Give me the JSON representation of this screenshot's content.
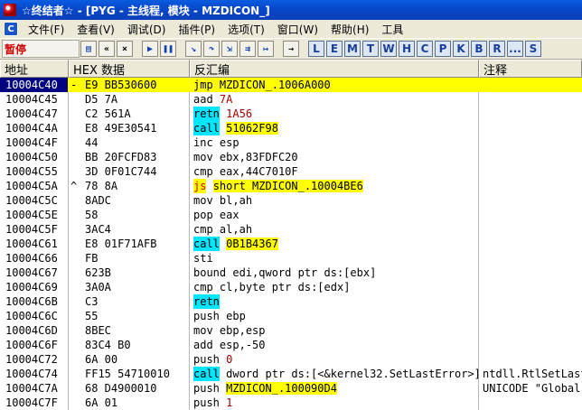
{
  "window": {
    "title": "☆终结者☆ - [PYG - 主线程, 模块 - MZDICON_]"
  },
  "menu": {
    "items": [
      "文件(F)",
      "查看(V)",
      "调试(D)",
      "插件(P)",
      "选项(T)",
      "窗口(W)",
      "帮助(H)",
      "工具"
    ]
  },
  "toolbar": {
    "status": "暂停",
    "letter_buttons": [
      "L",
      "E",
      "M",
      "T",
      "W",
      "H",
      "C",
      "P",
      "K",
      "B",
      "R",
      "...",
      "S"
    ]
  },
  "columns": {
    "address": "地址",
    "hex": "HEX 数据",
    "disassembly": "反汇编",
    "comment": "注释"
  },
  "rows": [
    {
      "addr": "10004C40",
      "mark": "-",
      "hex": "E9 BB530600",
      "mn": "jmp",
      "style": "",
      "arg": "MZDICON_.1006A000",
      "argstyle": "",
      "cmt": "",
      "selected": true
    },
    {
      "addr": "10004C45",
      "mark": "",
      "hex": "D5 7A",
      "mn": "aad",
      "style": "",
      "arg": "7A",
      "argstyle": "num",
      "cmt": ""
    },
    {
      "addr": "10004C47",
      "mark": "",
      "hex": "C2 561A",
      "mn": "retn",
      "style": "hl",
      "arg": "1A56",
      "argstyle": "num",
      "cmt": ""
    },
    {
      "addr": "10004C4A",
      "mark": "",
      "hex": "E8 49E30541",
      "mn": "call",
      "style": "hl",
      "arg": "51062F98",
      "argstyle": "yel",
      "cmt": ""
    },
    {
      "addr": "10004C4F",
      "mark": "",
      "hex": "44",
      "mn": "inc",
      "style": "",
      "arg": "esp",
      "argstyle": "",
      "cmt": ""
    },
    {
      "addr": "10004C50",
      "mark": "",
      "hex": "BB 20FCFD83",
      "mn": "mov",
      "style": "",
      "arg": "ebx,83FDFC20",
      "argstyle": "",
      "cmt": ""
    },
    {
      "addr": "10004C55",
      "mark": "",
      "hex": "3D 0F01C744",
      "mn": "cmp",
      "style": "",
      "arg": "eax,44C7010F",
      "argstyle": "",
      "cmt": ""
    },
    {
      "addr": "10004C5A",
      "mark": "^",
      "hex": "78 8A",
      "mn": "js",
      "style": "jmp",
      "arg": "short MZDICON_.10004BE6",
      "argstyle": "yel",
      "cmt": ""
    },
    {
      "addr": "10004C5C",
      "mark": "",
      "hex": "8ADC",
      "mn": "mov",
      "style": "",
      "arg": "bl,ah",
      "argstyle": "",
      "cmt": ""
    },
    {
      "addr": "10004C5E",
      "mark": "",
      "hex": "58",
      "mn": "pop",
      "style": "",
      "arg": "eax",
      "argstyle": "",
      "cmt": ""
    },
    {
      "addr": "10004C5F",
      "mark": "",
      "hex": "3AC4",
      "mn": "cmp",
      "style": "",
      "arg": "al,ah",
      "argstyle": "",
      "cmt": ""
    },
    {
      "addr": "10004C61",
      "mark": "",
      "hex": "E8 01F71AFB",
      "mn": "call",
      "style": "hl",
      "arg": "0B1B4367",
      "argstyle": "yel",
      "cmt": ""
    },
    {
      "addr": "10004C66",
      "mark": "",
      "hex": "FB",
      "mn": "sti",
      "style": "",
      "arg": "",
      "argstyle": "",
      "cmt": ""
    },
    {
      "addr": "10004C67",
      "mark": "",
      "hex": "623B",
      "mn": "bound",
      "style": "",
      "arg": "edi,qword ptr ds:[ebx]",
      "argstyle": "",
      "cmt": ""
    },
    {
      "addr": "10004C69",
      "mark": "",
      "hex": "3A0A",
      "mn": "cmp",
      "style": "",
      "arg": "cl,byte ptr ds:[edx]",
      "argstyle": "",
      "cmt": ""
    },
    {
      "addr": "10004C6B",
      "mark": "",
      "hex": "C3",
      "mn": "retn",
      "style": "hl",
      "arg": "",
      "argstyle": "",
      "cmt": ""
    },
    {
      "addr": "10004C6C",
      "mark": "",
      "hex": "55",
      "mn": "push",
      "style": "",
      "arg": "ebp",
      "argstyle": "",
      "cmt": ""
    },
    {
      "addr": "10004C6D",
      "mark": "",
      "hex": "8BEC",
      "mn": "mov",
      "style": "",
      "arg": "ebp,esp",
      "argstyle": "",
      "cmt": ""
    },
    {
      "addr": "10004C6F",
      "mark": "",
      "hex": "83C4 B0",
      "mn": "add",
      "style": "",
      "arg": "esp,-50",
      "argstyle": "",
      "cmt": ""
    },
    {
      "addr": "10004C72",
      "mark": "",
      "hex": "6A 00",
      "mn": "push",
      "style": "",
      "arg": "0",
      "argstyle": "num",
      "cmt": ""
    },
    {
      "addr": "10004C74",
      "mark": "",
      "hex": "FF15 54710010",
      "mn": "call",
      "style": "hl",
      "arg": "dword ptr ds:[<&kernel32.SetLastError>]",
      "argstyle": "",
      "cmt": "ntdll.RtlSetLastWin32Error"
    },
    {
      "addr": "10004C7A",
      "mark": "",
      "hex": "68 D4900010",
      "mn": "push",
      "style": "",
      "arg": "MZDICON_.100090D4",
      "argstyle": "yel",
      "cmt": "UNICODE \"Global\""
    },
    {
      "addr": "10004C7F",
      "mark": "",
      "hex": "6A 01",
      "mn": "push",
      "style": "",
      "arg": "1",
      "argstyle": "num",
      "cmt": ""
    }
  ],
  "colors": {
    "selection": "#ffff00",
    "mnemonic_highlight": "#00e6ff",
    "jump_text": "#d00000"
  }
}
